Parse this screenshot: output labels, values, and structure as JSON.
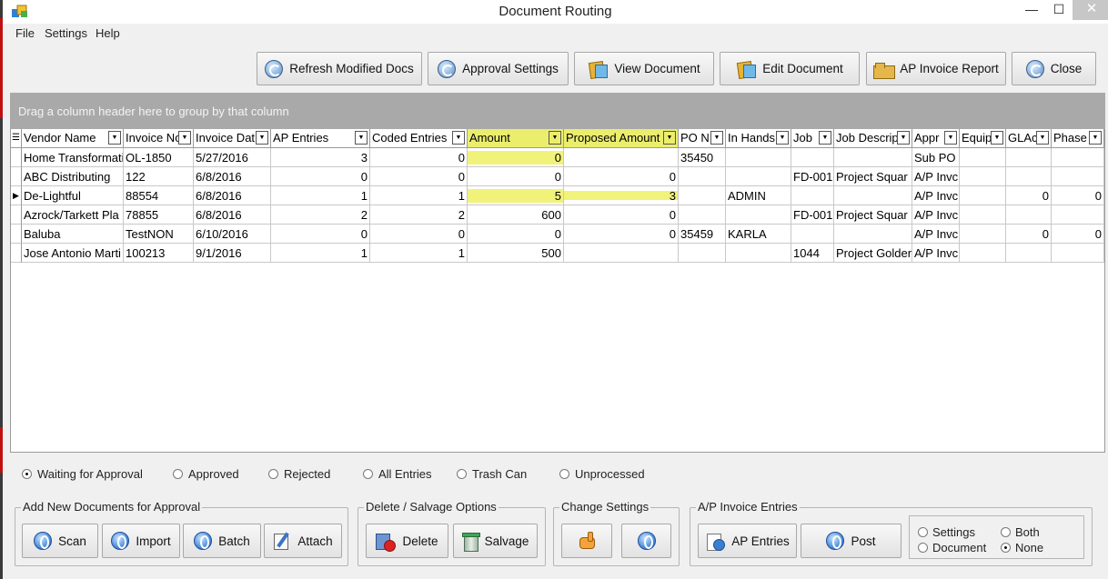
{
  "window": {
    "title": "Document Routing",
    "minimize": "—",
    "maximize": "☐",
    "close": "✕"
  },
  "menu": [
    "File",
    "Settings",
    "Help"
  ],
  "toolbar": {
    "refresh_modified": "Refresh Modified Docs",
    "approval_settings": "Approval Settings",
    "view_document": "View Document",
    "edit_document": "Edit Document",
    "ap_invoice_report": "AP Invoice Report",
    "close": "Close"
  },
  "grid": {
    "group_hint": "Drag a column header here to group by that column",
    "columns": [
      "Vendor Name",
      "Invoice No",
      "Invoice Dat",
      "AP Entries",
      "Coded Entries",
      "Amount",
      "Proposed Amount",
      "PO N",
      "In Hands",
      "Job",
      "Job Descrip",
      "Appr",
      "Equip",
      "GLAc",
      "Phase"
    ],
    "rows": [
      [
        "Home Transformati",
        "OL-1850",
        "5/27/2016",
        "3",
        "0",
        "0",
        "",
        "35450",
        "",
        "",
        "",
        "Sub PO",
        "",
        "",
        ""
      ],
      [
        "ABC Distributing",
        "122",
        "6/8/2016",
        "0",
        "0",
        "0",
        "0",
        "",
        "",
        "FD-001",
        "Project Squar",
        "A/P Invc",
        "",
        "",
        ""
      ],
      [
        "De-Lightful",
        "88554",
        "6/8/2016",
        "1",
        "1",
        "5",
        "3",
        "",
        "ADMIN",
        "",
        "",
        "A/P Invc",
        "",
        "0",
        "0"
      ],
      [
        "Azrock/Tarkett Pla",
        "78855",
        "6/8/2016",
        "2",
        "2",
        "600",
        "0",
        "",
        "",
        "FD-001",
        "Project Squar",
        "A/P Invc",
        "",
        "",
        ""
      ],
      [
        "Baluba",
        "TestNON",
        "6/10/2016",
        "0",
        "0",
        "0",
        "0",
        "35459",
        "KARLA",
        "",
        "",
        "A/P Invc",
        "",
        "0",
        "0"
      ],
      [
        "Jose Antonio Marti",
        "100213",
        "9/1/2016",
        "1",
        "1",
        "500",
        "",
        "",
        "",
        "1044",
        "Project Golder",
        "A/P Invc",
        "",
        "",
        ""
      ]
    ],
    "current_row_marker": "▶",
    "highlight_color": "#ebee6d"
  },
  "filters": {
    "waiting": "Waiting for Approval",
    "approved": "Approved",
    "rejected": "Rejected",
    "all": "All Entries",
    "trash": "Trash Can",
    "unprocessed": "Unprocessed",
    "selected": "waiting"
  },
  "panels": {
    "add_new": {
      "title": "Add New Documents for Approval",
      "scan": "Scan",
      "import": "Import",
      "batch": "Batch",
      "attach": "Attach"
    },
    "delete_salvage": {
      "title": "Delete / Salvage Options",
      "delete": "Delete",
      "salvage": "Salvage"
    },
    "change_settings": {
      "title": "Change Settings"
    },
    "ap_entries": {
      "title": "A/P Invoice Entries",
      "ap_entries": "AP Entries",
      "post": "Post",
      "opt_settings": "Settings",
      "opt_document": "Document",
      "opt_both": "Both",
      "opt_none": "None",
      "selected": "none"
    }
  }
}
